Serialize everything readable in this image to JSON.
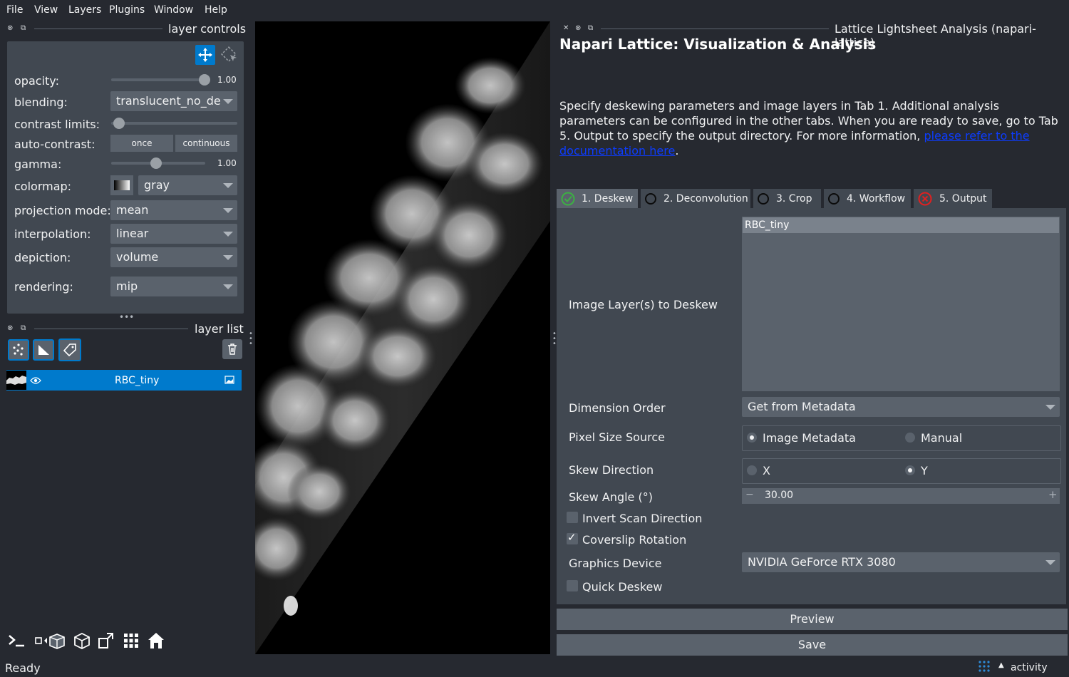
{
  "menu": [
    "File",
    "View",
    "Layers",
    "Plugins",
    "Window",
    "Help"
  ],
  "layer_controls": {
    "title": "layer controls",
    "opacity": {
      "label": "opacity:",
      "value": "1.00",
      "level": 1.0
    },
    "blending": {
      "label": "blending:",
      "value": "translucent_no_de"
    },
    "contrast_limits": {
      "label": "contrast limits:"
    },
    "auto_contrast": {
      "label": "auto-contrast:",
      "once": "once",
      "continuous": "continuous"
    },
    "gamma": {
      "label": "gamma:",
      "value": "1.00",
      "level": 0.5
    },
    "colormap": {
      "label": "colormap:",
      "value": "gray"
    },
    "projection_mode": {
      "label": "projection mode:",
      "value": "mean"
    },
    "interpolation": {
      "label": "interpolation:",
      "value": "linear"
    },
    "depiction": {
      "label": "depiction:",
      "value": "volume"
    },
    "rendering": {
      "label": "rendering:",
      "value": "mip"
    }
  },
  "layer_list": {
    "title": "layer list",
    "layers": [
      {
        "name": "RBC_tiny"
      }
    ]
  },
  "plugin": {
    "dock_title": "Lattice Lightsheet Analysis (napari-lattice)",
    "title": "Napari Lattice: Visualization & Analysis",
    "description": "Specify deskewing parameters and image layers in Tab 1.  Additional analysis parameters can be configured in the other tabs.  When you are ready to save, go to Tab 5.  Output to specify the output directory.  For more information, ",
    "doc_link": "please refer to the documentation here",
    "desc_end": ".",
    "tabs": [
      "1. Deskew",
      "2. Deconvolution",
      "3. Crop",
      "4. Workflow",
      "5. Output"
    ],
    "image_layers_label": "Image Layer(s) to Deskew",
    "image_layers": [
      "RBC_tiny"
    ],
    "dimension_order_label": "Dimension Order",
    "dimension_order_value": "Get from Metadata",
    "pixel_size_label": "Pixel Size Source",
    "pixel_size_options": [
      "Image Metadata",
      "Manual"
    ],
    "skew_direction_label": "Skew Direction",
    "skew_direction_options": [
      "X",
      "Y"
    ],
    "skew_angle_label": "Skew Angle (°)",
    "skew_angle_value": "30.00",
    "invert_scan_label": "Invert Scan Direction",
    "invert_scan_checked": false,
    "coverslip_label": "Coverslip Rotation",
    "coverslip_checked": true,
    "graphics_device_label": "Graphics Device",
    "graphics_device_value": "NVIDIA GeForce RTX 3080",
    "quick_deskew_label": "Quick Deskew",
    "quick_deskew_checked": false,
    "preview_label": "Preview",
    "save_label": "Save"
  },
  "status": {
    "text": "Ready",
    "activity": "activity"
  },
  "colors": {
    "accent": "#007acc",
    "bg": "#262930",
    "panel": "#414851",
    "widget": "#5a626c",
    "ok": "#3cb043",
    "error": "#e02020"
  }
}
